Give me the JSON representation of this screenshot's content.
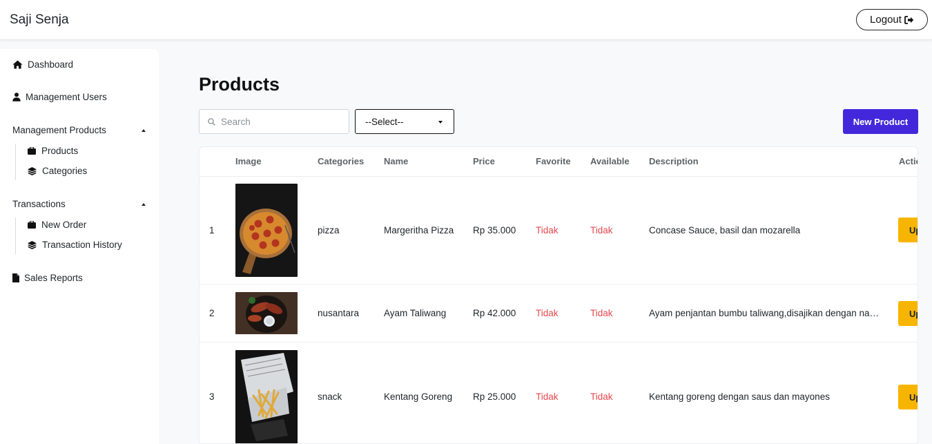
{
  "app": {
    "brand": "Saji Senja",
    "logout_label": "Logout"
  },
  "sidebar": {
    "dashboard": "Dashboard",
    "management_users": "Management Users",
    "management_products": {
      "label": "Management Products",
      "items": [
        {
          "label": "Products"
        },
        {
          "label": "Categories"
        }
      ]
    },
    "transactions": {
      "label": "Transactions",
      "items": [
        {
          "label": "New Order"
        },
        {
          "label": "Transaction History"
        }
      ]
    },
    "sales_reports": "Sales Reports"
  },
  "page": {
    "title": "Products"
  },
  "toolbar": {
    "search_placeholder": "Search",
    "select_value": "--Select--",
    "new_button": "New Product"
  },
  "table": {
    "headers": [
      "Image",
      "Categories",
      "Name",
      "Price",
      "Favorite",
      "Available",
      "Description",
      "Action"
    ],
    "rows": [
      {
        "no": "1",
        "category": "pizza",
        "name": "Margeritha Pizza",
        "price": "Rp 35.000",
        "favorite": "Tidak",
        "available": "Tidak",
        "description": "Concase Sauce, basil dan mozarella",
        "action": "Update"
      },
      {
        "no": "2",
        "category": "nusantara",
        "name": "Ayam Taliwang",
        "price": "Rp 42.000",
        "favorite": "Tidak",
        "available": "Tidak",
        "description": "Ayam penjantan bumbu taliwang,disajikan dengan nasi putih dan plecing kangkung",
        "action": "Update"
      },
      {
        "no": "3",
        "category": "snack",
        "name": "Kentang Goreng",
        "price": "Rp 25.000",
        "favorite": "Tidak",
        "available": "Tidak",
        "description": "Kentang goreng dengan saus dan mayones",
        "action": "Update"
      }
    ]
  },
  "colors": {
    "primary": "#4328db",
    "update_button": "#f7b500",
    "negative_text": "#e5484d"
  }
}
